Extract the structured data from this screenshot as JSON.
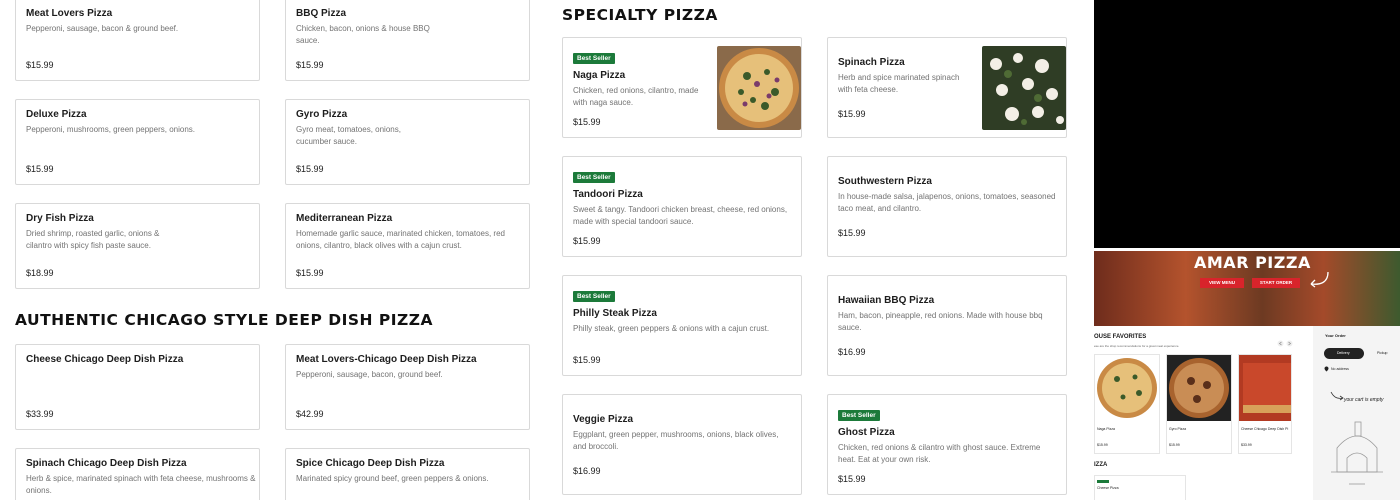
{
  "menu_left": {
    "row1": [
      {
        "name": "Meat Lovers Pizza",
        "desc": "Pepperoni, sausage, bacon & ground beef.",
        "price": "$15.99"
      },
      {
        "name": "BBQ Pizza",
        "desc": "Chicken, bacon, onions & house BBQ sauce.",
        "price": "$15.99"
      }
    ],
    "row2": [
      {
        "name": "Deluxe Pizza",
        "desc": "Pepperoni, mushrooms, green peppers, onions.",
        "price": "$15.99"
      },
      {
        "name": "Gyro Pizza",
        "desc": "Gyro meat, tomatoes, onions, cucumber sauce.",
        "price": "$15.99"
      }
    ],
    "row3": [
      {
        "name": "Dry Fish Pizza",
        "desc": "Dried shrimp, roasted garlic, onions & cilantro with spicy fish paste sauce.",
        "price": "$18.99"
      },
      {
        "name": "Mediterranean Pizza",
        "desc": "Homemade garlic sauce, marinated chicken, tomatoes, red onions, cilantro, black olives with a cajun crust.",
        "price": "$15.99"
      }
    ]
  },
  "chicago": {
    "title": "AUTHENTIC CHICAGO STYLE DEEP DISH PIZZA",
    "items": [
      {
        "name": "Cheese Chicago Deep Dish Pizza",
        "desc": "",
        "price": "$33.99"
      },
      {
        "name": "Meat Lovers-Chicago Deep Dish Pizza",
        "desc": "Pepperoni, sausage, bacon, ground beef.",
        "price": "$42.99"
      },
      {
        "name": "Spinach Chicago Deep Dish Pizza",
        "desc": "Herb & spice, marinated spinach with feta cheese, mushrooms & onions."
      },
      {
        "name": "Spice Chicago Deep Dish Pizza",
        "desc": "Marinated spicy ground beef, green peppers & onions."
      }
    ]
  },
  "specialty": {
    "title": "SPECIALTY PIZZA",
    "badge": "Best Seller",
    "items": [
      {
        "name": "Naga Pizza",
        "desc": "Chicken, red onions, cilantro, made with naga sauce.",
        "price": "$15.99"
      },
      {
        "name": "Spinach Pizza",
        "desc": "Herb and spice marinated spinach with feta cheese.",
        "price": "$15.99"
      },
      {
        "name": "Tandoori Pizza",
        "desc": "Sweet & tangy. Tandoori chicken breast, cheese, red onions, made with special tandoori sauce.",
        "price": "$15.99"
      },
      {
        "name": "Southwestern Pizza",
        "desc": "In house-made salsa, jalapenos, onions, tomatoes, seasoned taco meat, and cilantro.",
        "price": "$15.99"
      },
      {
        "name": "Philly Steak Pizza",
        "desc": "Philly steak, green peppers & onions with a cajun crust.",
        "price": "$15.99"
      },
      {
        "name": "Hawaiian BBQ Pizza",
        "desc": "Ham, bacon, pineapple, red onions. Made with house bbq sauce.",
        "price": "$16.99"
      },
      {
        "name": "Veggie Pizza",
        "desc": "Eggplant, green pepper, mushrooms, onions, black olives, and broccoli.",
        "price": "$16.99"
      },
      {
        "name": "Ghost Pizza",
        "desc": "Chicken, red onions & cilantro with ghost sauce. Extreme heat. Eat at your own risk.",
        "price": "$15.99"
      }
    ]
  },
  "preview": {
    "hero_title": "AMAR PIZZA",
    "view_menu": "VIEW MENU",
    "start_order": "START ORDER",
    "favorites_title": "OUSE FAVORITES",
    "favorites_sub": "ese are the shop recommendations for a great meal experience.",
    "fav_items": [
      {
        "name": "Naga Pizza",
        "price": "$15.99"
      },
      {
        "name": "Gyro Pizza",
        "price": "$15.99"
      },
      {
        "name": "Cheese Chicago Deep Dish Pi",
        "price": "$33.99"
      }
    ],
    "section_short": "IZZA",
    "mini_card": "Cheese Pizza",
    "your_order": "Your Order",
    "delivery": "Delivery",
    "pickup": "Pickup",
    "no_address": "No address",
    "cart_empty": "your cart is empty"
  },
  "colors": {
    "badge": "#1c7a3a",
    "hero_button": "#d8242b"
  }
}
